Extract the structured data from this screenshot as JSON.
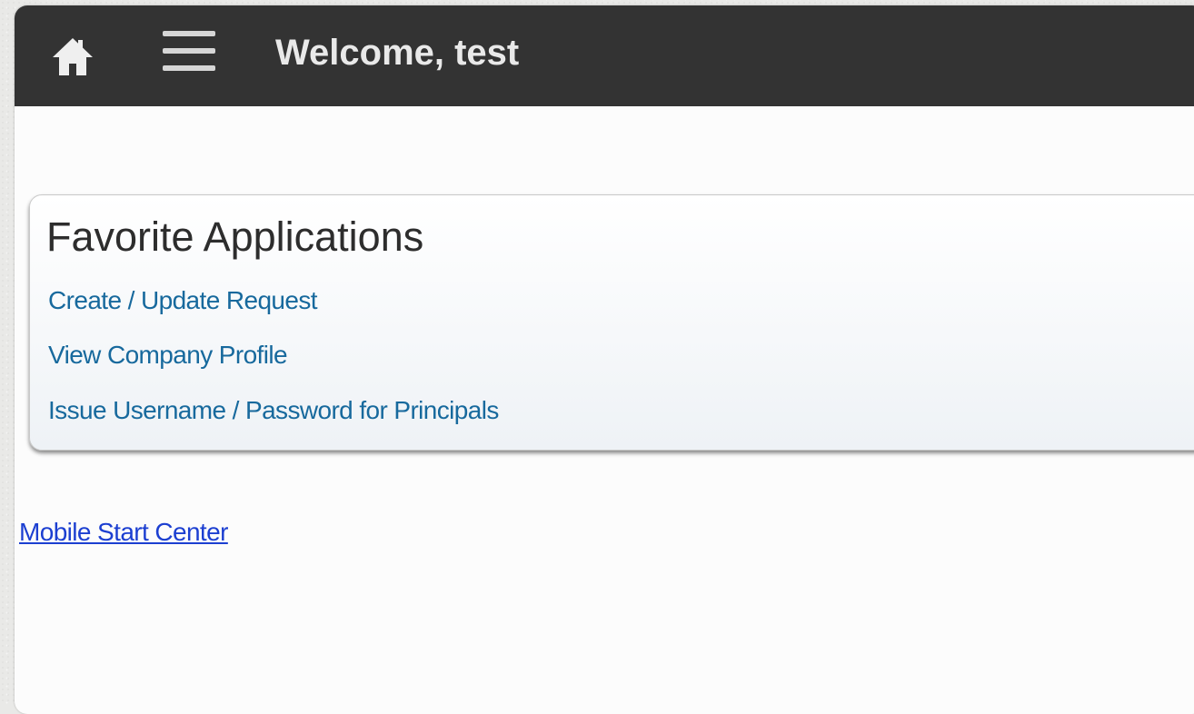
{
  "header": {
    "title": "Welcome, test",
    "home_icon": "home-icon",
    "menu_icon": "hamburger-menu-icon"
  },
  "favorites": {
    "title": "Favorite Applications",
    "links": [
      {
        "label": "Create / Update Request"
      },
      {
        "label": "View Company Profile"
      },
      {
        "label": "Issue Username / Password for Principals"
      }
    ]
  },
  "footer": {
    "mobile_start_center": "Mobile Start Center"
  },
  "colors": {
    "header_bg": "#333333",
    "link_blue": "#17699d",
    "hyperlink_blue": "#1c3fd1"
  }
}
